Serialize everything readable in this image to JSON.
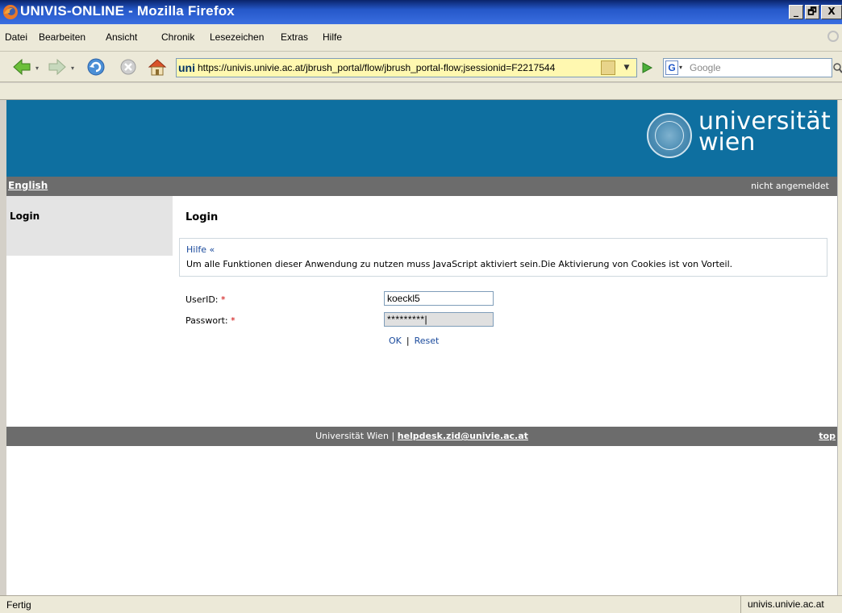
{
  "window": {
    "title": "UNIVIS-ONLINE - Mozilla Firefox",
    "minimize": "_",
    "maximize": "🗗",
    "close": "X"
  },
  "menu": {
    "items": [
      "Datei",
      "Bearbeiten",
      "Ansicht",
      "Chronik",
      "Lesezeichen",
      "Extras",
      "Hilfe"
    ]
  },
  "nav": {
    "url_favicon": "uni",
    "url": "https://univis.univie.ac.at/jbrush_portal/flow/jbrush_portal-flow;jsessionid=F2217544",
    "search_engine": "G",
    "search_placeholder": "Google"
  },
  "page": {
    "logo_line1": "universität",
    "logo_line2": "wien",
    "language_link": "English",
    "login_status": "nicht angemeldet",
    "sidebar_item": "Login",
    "title": "Login",
    "help_link": "Hilfe «",
    "help_message": "Um alle Funktionen dieser Anwendung zu nutzen muss JavaScript aktiviert sein.Die Aktivierung von Cookies ist von Vorteil.",
    "userid_label": "UserID:",
    "password_label": "Passwort:",
    "required_marker": "*",
    "userid_value": "koeckl5",
    "password_value": "*********|",
    "ok_link": "OK",
    "separator": "|",
    "reset_link": "Reset",
    "footer_org": "Universität Wien |",
    "footer_mail": "helpdesk.zid@univie.ac.at",
    "footer_top": "top"
  },
  "statusbar": {
    "left": "Fertig",
    "right": "univis.univie.ac.at"
  },
  "colors": {
    "banner": "#0e6fa0",
    "grey_bar": "#6c6c6c",
    "link": "#1a4a9c",
    "required": "#cc0000",
    "titlebar": "#2558c9"
  }
}
